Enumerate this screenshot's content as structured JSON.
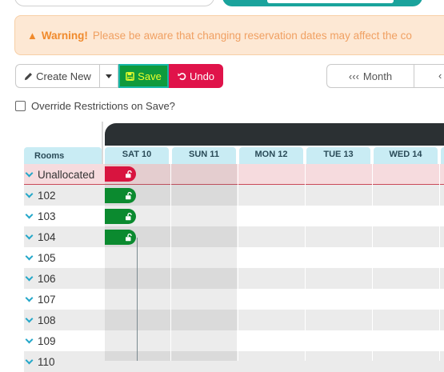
{
  "warning": {
    "label": "Warning!",
    "message": "Please be aware that changing reservation dates may affect the co"
  },
  "toolbar": {
    "create_label": "Create New",
    "save_label": "Save",
    "undo_label": "Undo",
    "prev_month_label": "Month",
    "prev_month_arrows": "‹‹‹",
    "next_arrows": "‹"
  },
  "override": {
    "label": "Override Restrictions on Save?",
    "checked": false
  },
  "scheduler": {
    "rooms_header": "Rooms",
    "days": [
      "SAT 10",
      "SUN 11",
      "MON 12",
      "TUE 13",
      "WED 14"
    ],
    "rooms": [
      "Unallocated",
      "102",
      "103",
      "104",
      "105",
      "106",
      "107",
      "108",
      "109",
      "110"
    ]
  },
  "icons": {
    "warning": "warning-triangle-icon",
    "create": "pencil-icon",
    "save": "floppy-disk-icon",
    "undo": "undo-icon",
    "lock": "unlock-icon",
    "chevron": "chevron-down-icon"
  },
  "colors": {
    "save": "#0f9a3c",
    "undo": "#e0134a",
    "reservation_unallocated": "#d8143f",
    "reservation_allocated": "#0b8a2f",
    "header": "#c9ecf4",
    "accent_teal": "#1aa39c"
  }
}
